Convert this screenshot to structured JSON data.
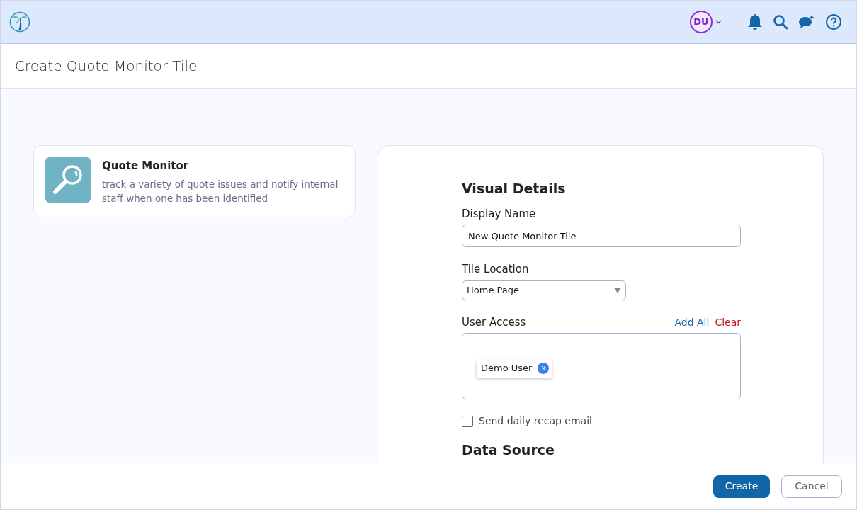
{
  "header": {
    "avatar_initials": "DU"
  },
  "page_title": "Create Quote Monitor Tile",
  "template_card": {
    "title": "Quote Monitor",
    "description": "track a variety of quote issues and notify internal staff when one has been identified"
  },
  "form": {
    "section_title": "Visual Details",
    "display_name": {
      "label": "Display Name",
      "value": "New Quote Monitor Tile"
    },
    "tile_location": {
      "label": "Tile Location",
      "value": "Home Page"
    },
    "user_access": {
      "label": "User Access",
      "add_all": "Add All",
      "clear": "Clear",
      "users": [
        {
          "name": "Demo User",
          "remove": "x"
        }
      ]
    },
    "recap_email": {
      "label": "Send daily recap email",
      "checked": false
    },
    "next_section_title": "Data Source"
  },
  "footer": {
    "buttons": [
      {
        "label": "Create",
        "kind": "primary"
      },
      {
        "label": "Cancel",
        "kind": "secondary"
      }
    ]
  }
}
